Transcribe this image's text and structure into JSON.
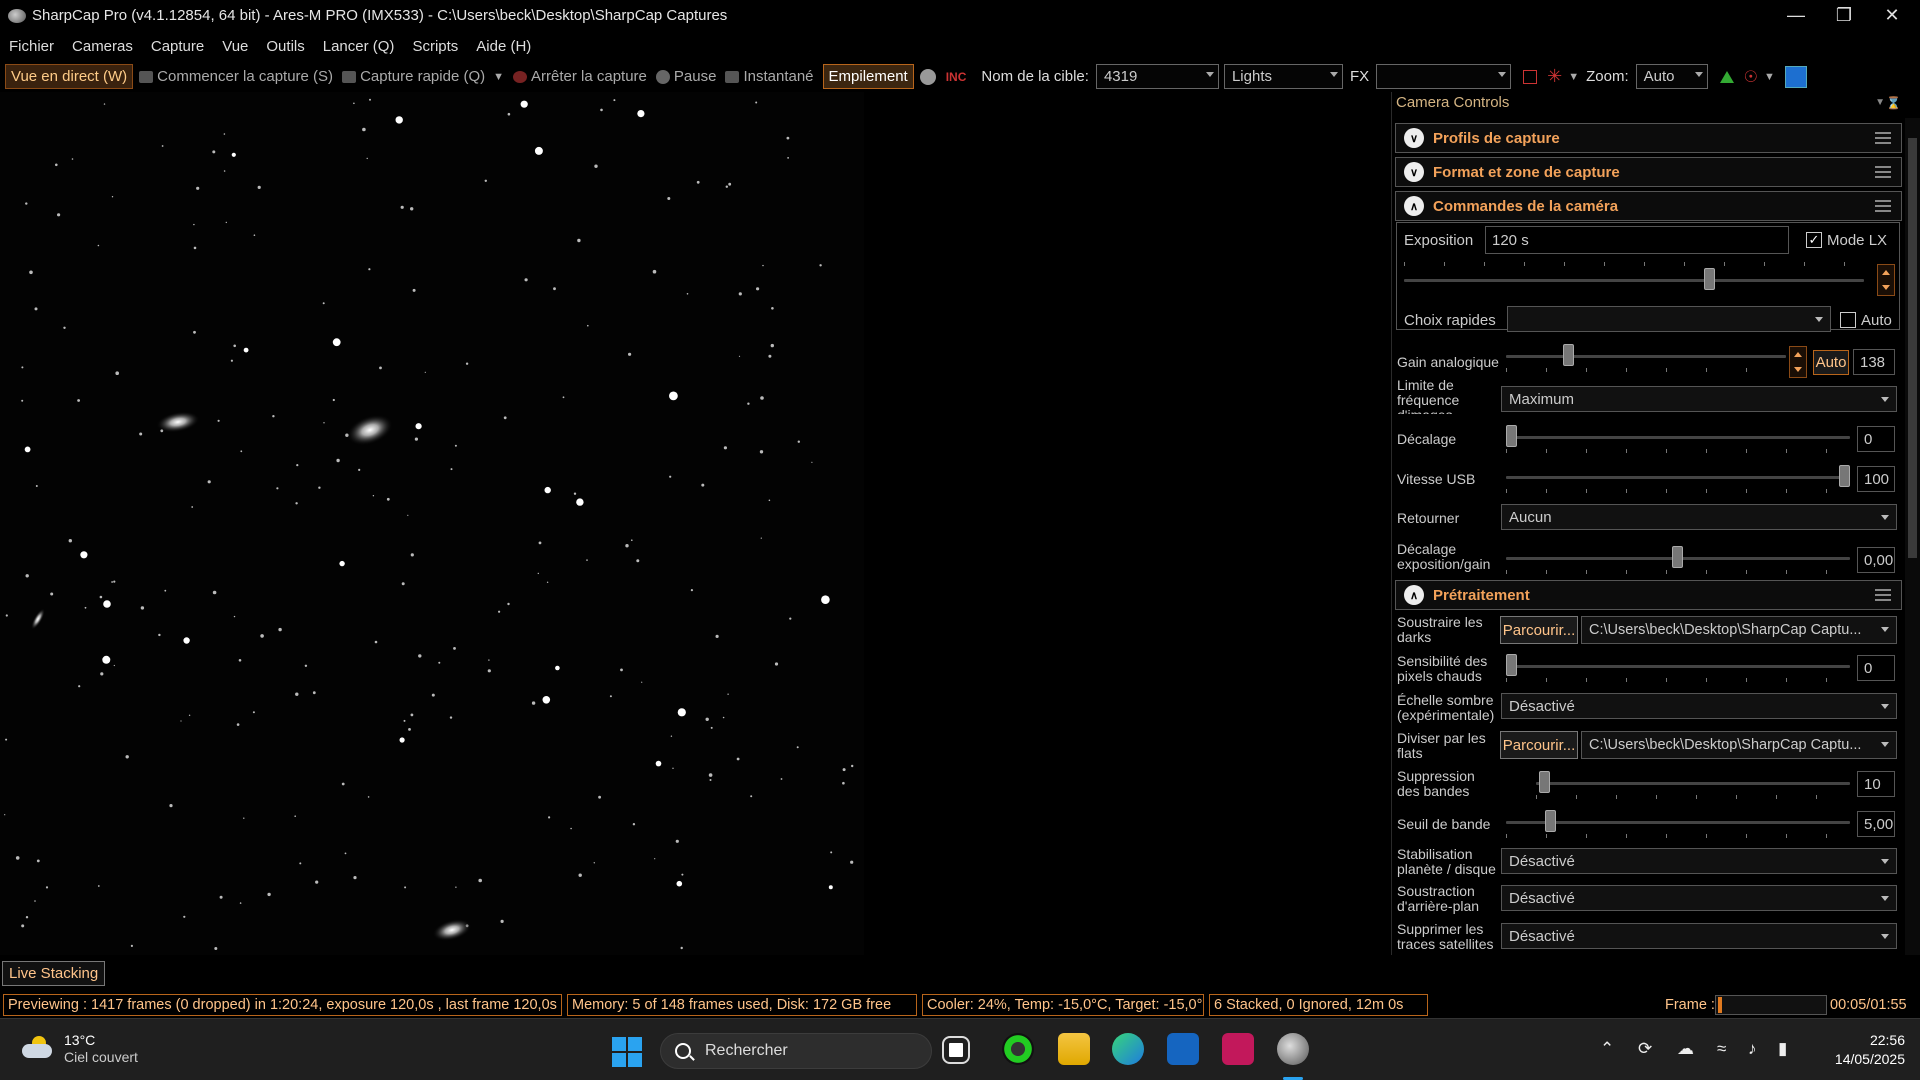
{
  "window": {
    "title": "SharpCap Pro (v4.1.12854, 64 bit) - Ares-M PRO (IMX533) - C:\\Users\\beck\\Desktop\\SharpCap Captures",
    "controls": [
      "minimize-icon",
      "restore-icon",
      "close-icon"
    ]
  },
  "menu": [
    "Fichier",
    "Cameras",
    "Capture",
    "Vue",
    "Outils",
    "Lancer (Q)",
    "Scripts",
    "Aide (H)"
  ],
  "toolbar": {
    "live_view": "Vue en direct (W)",
    "start_capture": "Commencer la capture (S)",
    "quick_capture": "Capture rapide (Q)",
    "stop_capture": "Arrêter la capture",
    "pause": "Pause",
    "snapshot": "Instantané",
    "stacking": "Empilement",
    "target_label": "Nom de la cible:",
    "target_value": "4319",
    "frame_type": "Lights",
    "fx_label": "FX",
    "fx_value": "",
    "zoom_label": "Zoom:",
    "zoom_value": "Auto"
  },
  "panel": {
    "title": "Camera Controls",
    "sections": {
      "profiles": "Profils de capture",
      "format": "Format et zone de capture",
      "camera": "Commandes de la caméra",
      "preprocessing": "Prétraitement"
    },
    "camera": {
      "exposure_label": "Exposition",
      "exposure_value": "120 s",
      "lx_label": "Mode LX",
      "lx_checked": true,
      "quick_label": "Choix rapides",
      "quick_value": "",
      "auto_label": "Auto",
      "gain_label": "Gain analogique",
      "gain_auto": "Auto",
      "gain_value": "138",
      "framerate_label": "Limite de fréquence d'images",
      "framerate_value": "Maximum",
      "offset_label": "Décalage",
      "offset_value": "0",
      "usb_label": "Vitesse USB",
      "usb_value": "100",
      "flip_label": "Retourner",
      "flip_value": "Aucun",
      "expgain_label": "Décalage exposition/gain",
      "expgain_value": "0,00"
    },
    "pre": {
      "darks_label": "Soustraire les darks",
      "browse": "Parcourir...",
      "darks_path": "C:\\Users\\beck\\Desktop\\SharpCap Captu...",
      "hotpix_label": "Sensibilité des pixels chauds",
      "hotpix_value": "0",
      "darkscale_label": "Échelle sombre (expérimentale)",
      "disabled": "Désactivé",
      "flats_label": "Diviser par les flats",
      "flats_path": "C:\\Users\\beck\\Desktop\\SharpCap Captu...",
      "banding_label": "Suppression des bandes",
      "banding_value": "10",
      "bandthr_label": "Seuil de bande",
      "bandthr_value": "5,00",
      "planet_label": "Stabilisation planète / disque",
      "bg_label": "Soustraction d'arrière-plan",
      "sat_label": "Supprimer les traces satellites"
    }
  },
  "live_stacking_tab": "Live Stacking",
  "status": {
    "preview": "Previewing : 1417 frames (0 dropped) in 1:20:24, exposure 120,0s , last frame 120,0s",
    "memory": "Memory: 5 of 148 frames used, Disk: 172 GB free",
    "cooler": "Cooler: 24%, Temp: -15,0°C, Target: -15,0°",
    "stacked": "6 Stacked, 0 Ignored, 12m 0s",
    "frame_label": "Frame :",
    "frame_progress": 0.04,
    "time": "00:05/01:55"
  },
  "taskbar": {
    "temp": "13°C",
    "weather": "Ciel couvert",
    "search": "Rechercher",
    "clock_time": "22:56",
    "clock_date": "14/05/2025",
    "accent": "#2aa3f0"
  },
  "colors": {
    "accent_orange": "#f3a25a",
    "border_orange": "#b8651b"
  }
}
